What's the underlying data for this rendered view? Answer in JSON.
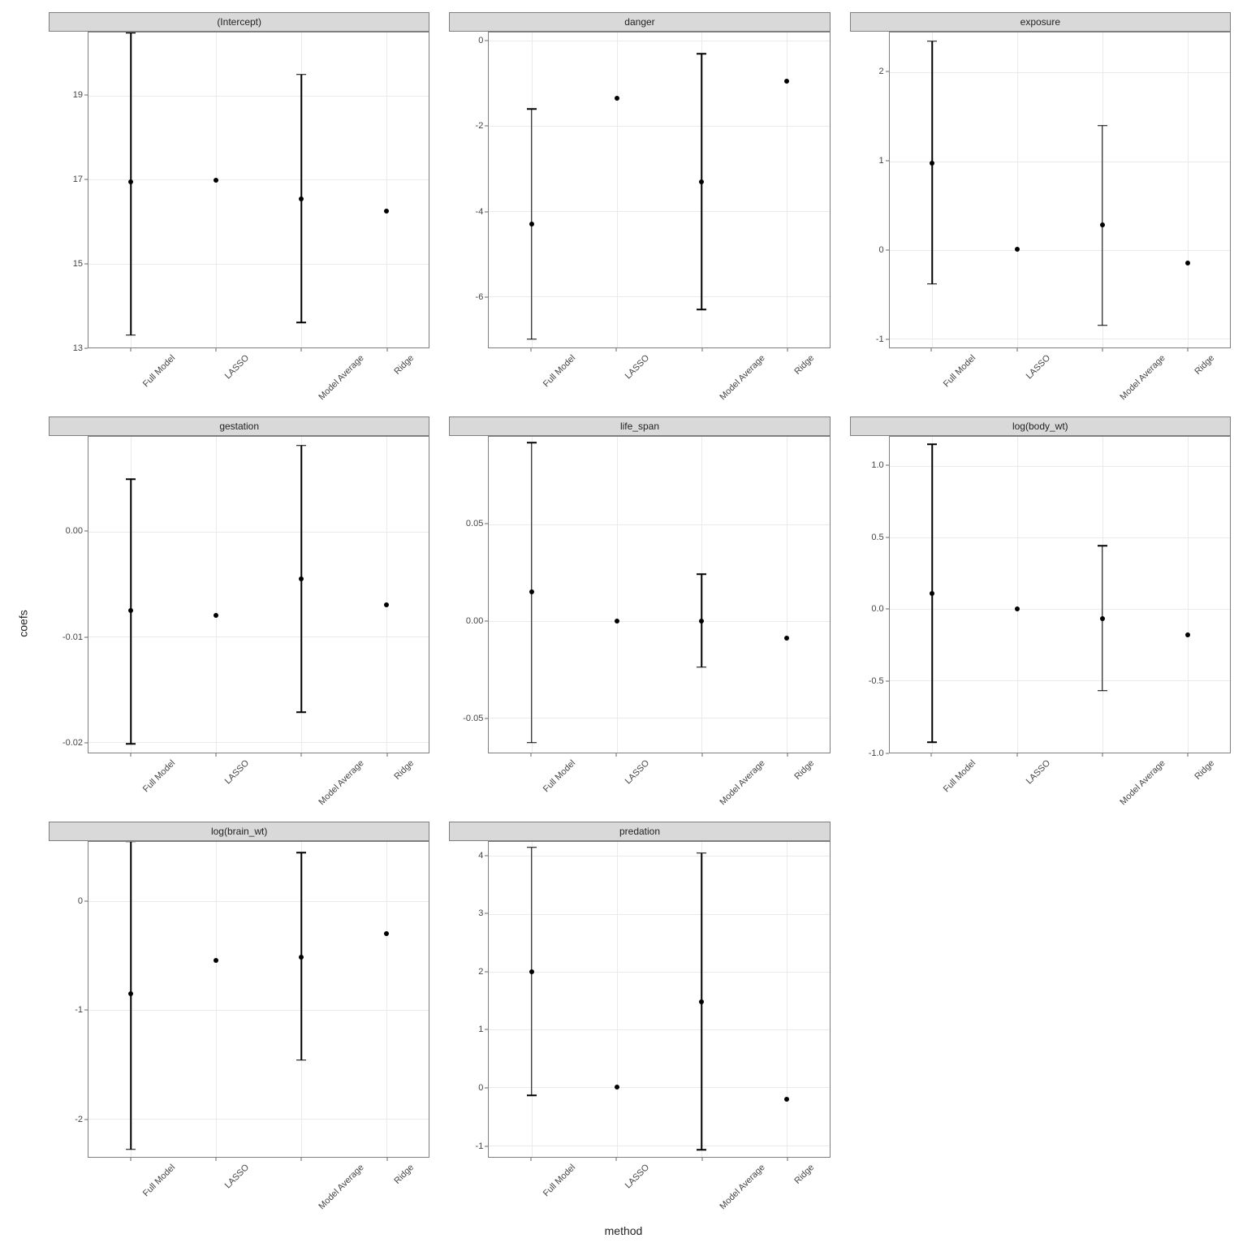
{
  "xlabel": "method",
  "ylabel": "coefs",
  "categories": [
    "Full Model",
    "LASSO",
    "Model Average",
    "Ridge"
  ],
  "chart_data": [
    {
      "type": "pointrange",
      "title": "(Intercept)",
      "ylim": [
        13,
        20.5
      ],
      "yticks": [
        13,
        15,
        17,
        19
      ],
      "series": [
        {
          "method": "Full Model",
          "coef": 16.95,
          "low": 13.3,
          "high": 20.5
        },
        {
          "method": "LASSO",
          "coef": 16.98,
          "low": null,
          "high": null
        },
        {
          "method": "Model Average",
          "coef": 16.55,
          "low": 13.6,
          "high": 19.5
        },
        {
          "method": "Ridge",
          "coef": 16.25,
          "low": null,
          "high": null
        }
      ]
    },
    {
      "type": "pointrange",
      "title": "danger",
      "ylim": [
        -7.2,
        0.2
      ],
      "yticks": [
        -6,
        -4,
        -2,
        0
      ],
      "series": [
        {
          "method": "Full Model",
          "coef": -4.3,
          "low": -7.0,
          "high": -1.6
        },
        {
          "method": "LASSO",
          "coef": -1.35,
          "low": null,
          "high": null
        },
        {
          "method": "Model Average",
          "coef": -3.3,
          "low": -6.3,
          "high": -0.3
        },
        {
          "method": "Ridge",
          "coef": -0.95,
          "low": null,
          "high": null
        }
      ]
    },
    {
      "type": "pointrange",
      "title": "exposure",
      "ylim": [
        -1.1,
        2.45
      ],
      "yticks": [
        -1,
        0,
        1,
        2
      ],
      "series": [
        {
          "method": "Full Model",
          "coef": 0.98,
          "low": -0.38,
          "high": 2.35
        },
        {
          "method": "LASSO",
          "coef": 0.01,
          "low": null,
          "high": null
        },
        {
          "method": "Model Average",
          "coef": 0.28,
          "low": -0.85,
          "high": 1.4
        },
        {
          "method": "Ridge",
          "coef": -0.15,
          "low": null,
          "high": null
        }
      ]
    },
    {
      "type": "pointrange",
      "title": "gestation",
      "ylim": [
        -0.021,
        0.009
      ],
      "yticks": [
        -0.02,
        -0.01,
        0.0
      ],
      "series": [
        {
          "method": "Full Model",
          "coef": -0.0075,
          "low": -0.0202,
          "high": 0.005
        },
        {
          "method": "LASSO",
          "coef": -0.008,
          "low": null,
          "high": null
        },
        {
          "method": "Model Average",
          "coef": -0.0045,
          "low": -0.0172,
          "high": 0.0082
        },
        {
          "method": "Ridge",
          "coef": -0.007,
          "low": null,
          "high": null
        }
      ]
    },
    {
      "type": "pointrange",
      "title": "life_span",
      "ylim": [
        -0.068,
        0.095
      ],
      "yticks": [
        -0.05,
        0.0,
        0.05
      ],
      "series": [
        {
          "method": "Full Model",
          "coef": 0.015,
          "low": -0.063,
          "high": 0.092
        },
        {
          "method": "LASSO",
          "coef": 0.0,
          "low": null,
          "high": null
        },
        {
          "method": "Model Average",
          "coef": 0.0,
          "low": -0.024,
          "high": 0.024
        },
        {
          "method": "Ridge",
          "coef": -0.009,
          "low": null,
          "high": null
        }
      ]
    },
    {
      "type": "pointrange",
      "title": "log(body_wt)",
      "ylim": [
        -1.0,
        1.2
      ],
      "yticks": [
        -1.0,
        -0.5,
        0.0,
        0.5,
        1.0
      ],
      "series": [
        {
          "method": "Full Model",
          "coef": 0.11,
          "low": -0.93,
          "high": 1.15
        },
        {
          "method": "LASSO",
          "coef": 0.0,
          "low": null,
          "high": null
        },
        {
          "method": "Model Average",
          "coef": -0.07,
          "low": -0.57,
          "high": 0.44
        },
        {
          "method": "Ridge",
          "coef": -0.18,
          "low": null,
          "high": null
        }
      ]
    },
    {
      "type": "pointrange",
      "title": "log(brain_wt)",
      "ylim": [
        -2.35,
        0.55
      ],
      "yticks": [
        -2,
        -1,
        0
      ],
      "series": [
        {
          "method": "Full Model",
          "coef": -0.85,
          "low": -2.28,
          "high": 0.55
        },
        {
          "method": "LASSO",
          "coef": -0.54,
          "low": null,
          "high": null
        },
        {
          "method": "Model Average",
          "coef": -0.51,
          "low": -1.46,
          "high": 0.45
        },
        {
          "method": "Ridge",
          "coef": -0.3,
          "low": null,
          "high": null
        }
      ]
    },
    {
      "type": "pointrange",
      "title": "predation",
      "ylim": [
        -1.2,
        4.25
      ],
      "yticks": [
        -1,
        0,
        1,
        2,
        3,
        4
      ],
      "series": [
        {
          "method": "Full Model",
          "coef": 2.0,
          "low": -0.14,
          "high": 4.15
        },
        {
          "method": "LASSO",
          "coef": 0.0,
          "low": null,
          "high": null
        },
        {
          "method": "Model Average",
          "coef": 1.48,
          "low": -1.08,
          "high": 4.05
        },
        {
          "method": "Ridge",
          "coef": -0.2,
          "low": null,
          "high": null
        }
      ]
    }
  ]
}
